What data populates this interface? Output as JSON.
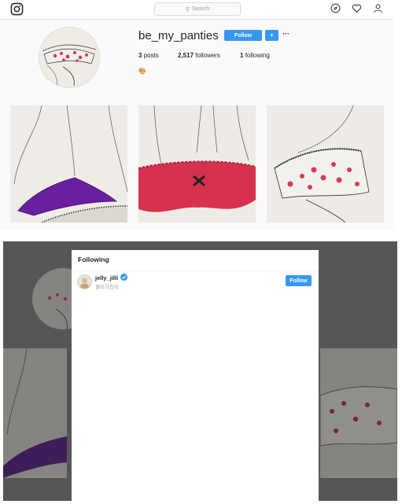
{
  "profile": {
    "username": "be_my_panties",
    "follow_label": "Follow",
    "dropdown_label": "▾",
    "more_label": "···",
    "posts_count": "3",
    "posts_label": "posts",
    "followers_count": "2,517",
    "followers_label": "followers",
    "following_count": "1",
    "following_label": "following",
    "bio_emoji": "🎨"
  },
  "navbar": {
    "search_placeholder": "Search",
    "icons": [
      "instagram-logo",
      "compass-icon",
      "heart-icon",
      "user-icon"
    ]
  },
  "posts": [
    {
      "description": "purple underwear drawing"
    },
    {
      "description": "red lace underwear drawing"
    },
    {
      "description": "floral underwear drawing"
    }
  ],
  "modal": {
    "title": "Following",
    "rows": [
      {
        "username": "jelly_jilli",
        "subtitle": "젤리가진리",
        "verified": true,
        "follow_label": "Follow"
      }
    ]
  },
  "colors": {
    "accent": "#3897f0",
    "purple": "#6a1fa0",
    "red": "#d6324e",
    "pink": "#e85a8a"
  }
}
